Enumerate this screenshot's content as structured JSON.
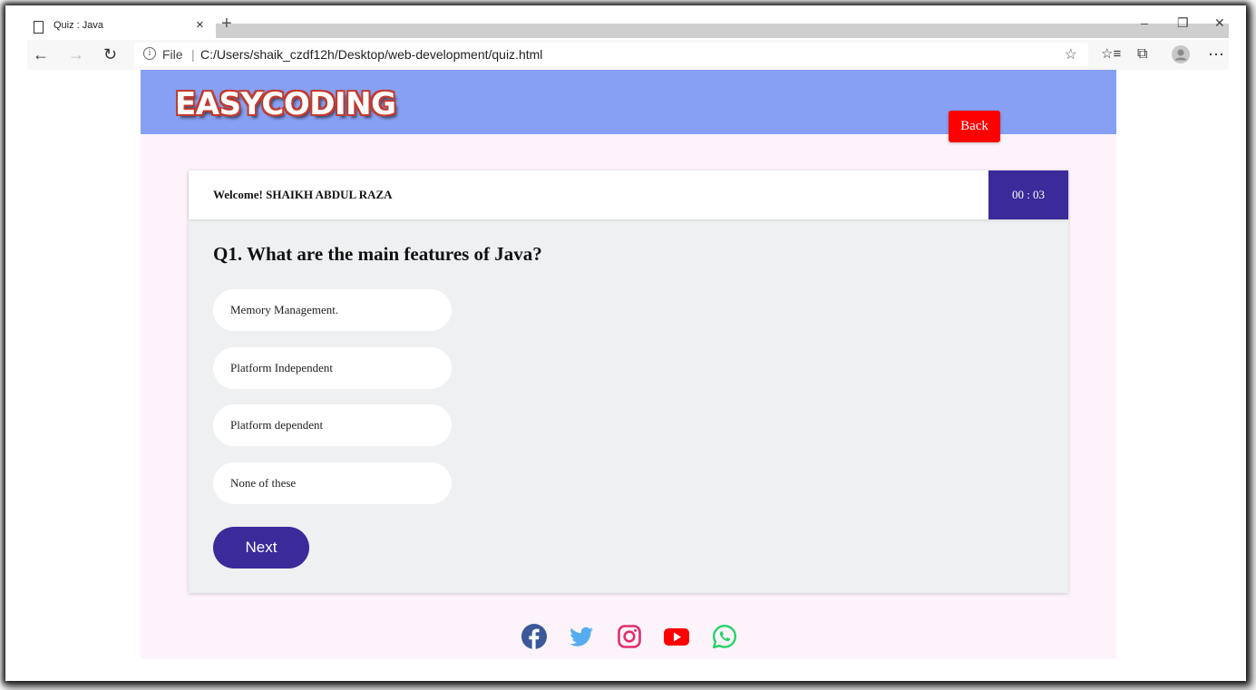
{
  "browser": {
    "tab_title": "Quiz : Java",
    "tab_close": "×",
    "new_tab": "+",
    "file_label": "File",
    "separator": "|",
    "url": "C:/Users/shaik_czdf12h/Desktop/web-development/quiz.html"
  },
  "header": {
    "logo": "EASYCODING",
    "back_label": "Back"
  },
  "quiz": {
    "welcome": "Welcome! SHAIKH ABDUL RAZA",
    "timer": "00 : 03",
    "question": "Q1. What are the main features of Java?",
    "options": [
      "Memory Management.",
      "Platform Independent",
      "Platform dependent",
      "None of these"
    ],
    "next_label": "Next"
  },
  "social": [
    "facebook-icon",
    "twitter-icon",
    "instagram-icon",
    "youtube-icon",
    "whatsapp-icon"
  ],
  "colors": {
    "header_bg": "#87a0f3",
    "page_bg": "#fdf3fb",
    "accent": "#3a2a9a",
    "back_button": "#ff0000"
  }
}
